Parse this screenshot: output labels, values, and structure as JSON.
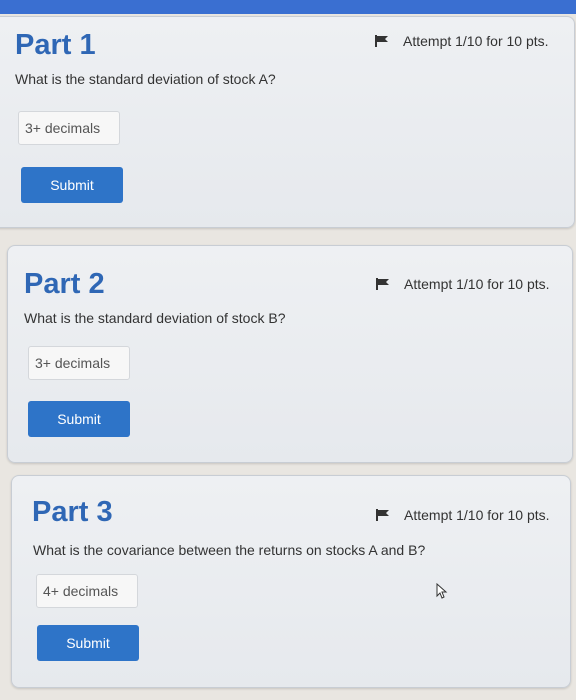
{
  "parts": [
    {
      "title": "Part 1",
      "attempt": "Attempt 1/10 for 10 pts.",
      "question": "What is the standard deviation of stock A?",
      "placeholder": "3+ decimals",
      "submit_label": "Submit"
    },
    {
      "title": "Part 2",
      "attempt": "Attempt 1/10 for 10 pts.",
      "question": "What is the standard deviation of stock B?",
      "placeholder": "3+ decimals",
      "submit_label": "Submit"
    },
    {
      "title": "Part 3",
      "attempt": "Attempt 1/10 for 10 pts.",
      "question": "What is the covariance between the returns on stocks A and B?",
      "placeholder": "4+ decimals",
      "submit_label": "Submit"
    }
  ],
  "icons": {
    "attempt": "flag-icon",
    "pointer": "mouse-pointer-icon"
  },
  "colors": {
    "title": "#2f67b5",
    "submit": "#2e74c8",
    "topbar": "#3a6fd1"
  }
}
